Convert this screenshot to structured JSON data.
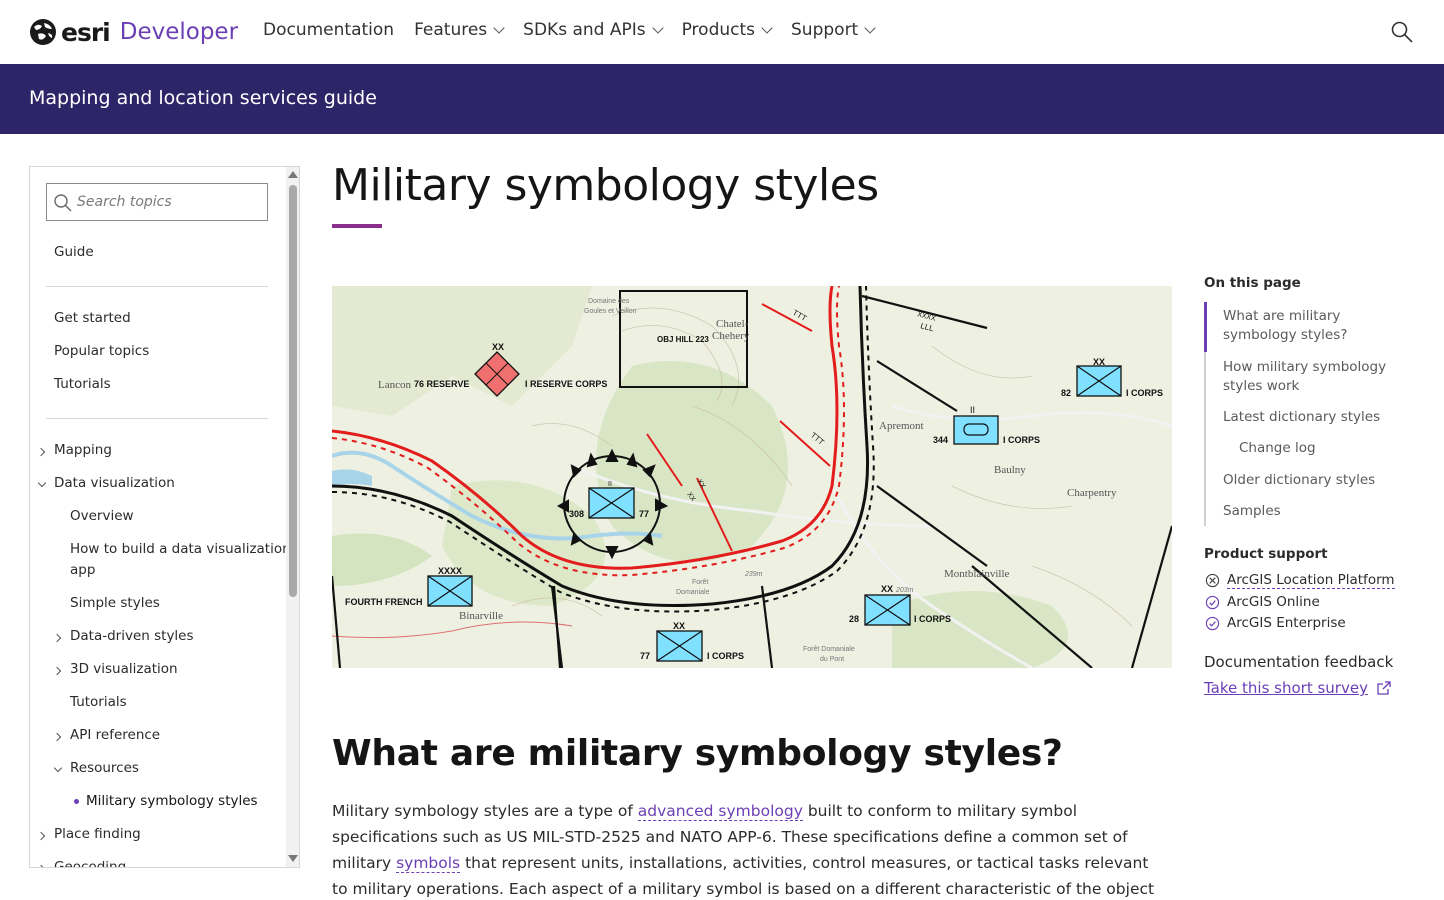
{
  "header": {
    "logo_text": "esri",
    "logo_product": "Developer",
    "nav": [
      {
        "label": "Documentation",
        "has_menu": false
      },
      {
        "label": "Features",
        "has_menu": true
      },
      {
        "label": "SDKs and APIs",
        "has_menu": true
      },
      {
        "label": "Products",
        "has_menu": true
      },
      {
        "label": "Support",
        "has_menu": true
      }
    ]
  },
  "banner": {
    "title": "Mapping and location services guide"
  },
  "sidebar": {
    "search_placeholder": "Search topics",
    "items": [
      {
        "label": "Guide"
      },
      {
        "label": "Get started"
      },
      {
        "label": "Popular topics"
      },
      {
        "label": "Tutorials"
      },
      {
        "label": "Mapping"
      },
      {
        "label": "Data visualization"
      },
      {
        "label": "Overview"
      },
      {
        "label": "How to build a data visualization"
      },
      {
        "label": "app"
      },
      {
        "label": "Simple styles"
      },
      {
        "label": "Data-driven styles"
      },
      {
        "label": "3D visualization"
      },
      {
        "label": "Tutorials"
      },
      {
        "label": "API reference"
      },
      {
        "label": "Resources"
      },
      {
        "label": "Military symbology styles"
      },
      {
        "label": "Place finding"
      },
      {
        "label": "Geocoding"
      }
    ]
  },
  "main": {
    "title": "Military symbology styles",
    "section_title": "What are military symbology styles?",
    "para": {
      "t1": "Military symbology styles are a type of ",
      "link1": "advanced symbology",
      "t2": " built to conform to military symbol specifications such as US MIL-STD-2525 and NATO APP-6. These specifications define a common set of military ",
      "link2": "symbols",
      "t3": " that represent units, installations, activities, control measures, or tactical tasks relevant to military operations. Each aspect of a military symbol is based on a different characteristic of the object it represents. Each symbol has a unique symbol"
    }
  },
  "map_labels": {
    "echelon_xx": "XX",
    "echelon_xxxx": "XXXX",
    "echelon_ii": "II",
    "reserve": "76 RESERVE",
    "reserve_corps": "I RESERVE CORPS",
    "objective": "OBJ HILL 223",
    "fourth_french": "FOURTH FRENCH",
    "i_corps": "I CORPS",
    "unit_82": "82",
    "unit_344": "344",
    "unit_308": "308",
    "unit_77": "77",
    "unit_28": "28",
    "llll": "LLL",
    "ttt": "TTT",
    "places": {
      "lancon": "Lancon",
      "chatel": "Chatel-",
      "chehery": "Chehery",
      "apremont": "Apremont",
      "baulny": "Baulny",
      "charpentry": "Charpentry",
      "montblainville": "Montblainville",
      "binarville": "Binarville",
      "domaine": "Domaine des",
      "goules": "Goules et Veillon",
      "foret": "Forêt",
      "domaniale": "Domaniale",
      "foret_dom": "Forêt Domaniale",
      "du_pont": "du Pont",
      "elev_239": "239m",
      "elev_203": "203m"
    }
  },
  "rail": {
    "on_this_page": "On this page",
    "toc": [
      {
        "label": "What are military symbology styles?"
      },
      {
        "label": "How military symbology styles work"
      },
      {
        "label": "Latest dictionary styles"
      },
      {
        "label": "Change log"
      },
      {
        "label": "Older dictionary styles"
      },
      {
        "label": "Samples"
      }
    ],
    "product_support": "Product support",
    "support": [
      {
        "label": "ArcGIS Location Platform",
        "status": "not-supported"
      },
      {
        "label": "ArcGIS Online",
        "status": "supported"
      },
      {
        "label": "ArcGIS Enterprise",
        "status": "supported"
      }
    ],
    "feedback_label": "Documentation feedback",
    "survey_label": "Take this short survey"
  },
  "colors": {
    "brand_purple": "#6b3fb5",
    "banner_bg": "#2d2567",
    "title_accent": "#8c2d8c",
    "friendly_blue": "#80e0ff",
    "hostile_red": "#f07070"
  }
}
